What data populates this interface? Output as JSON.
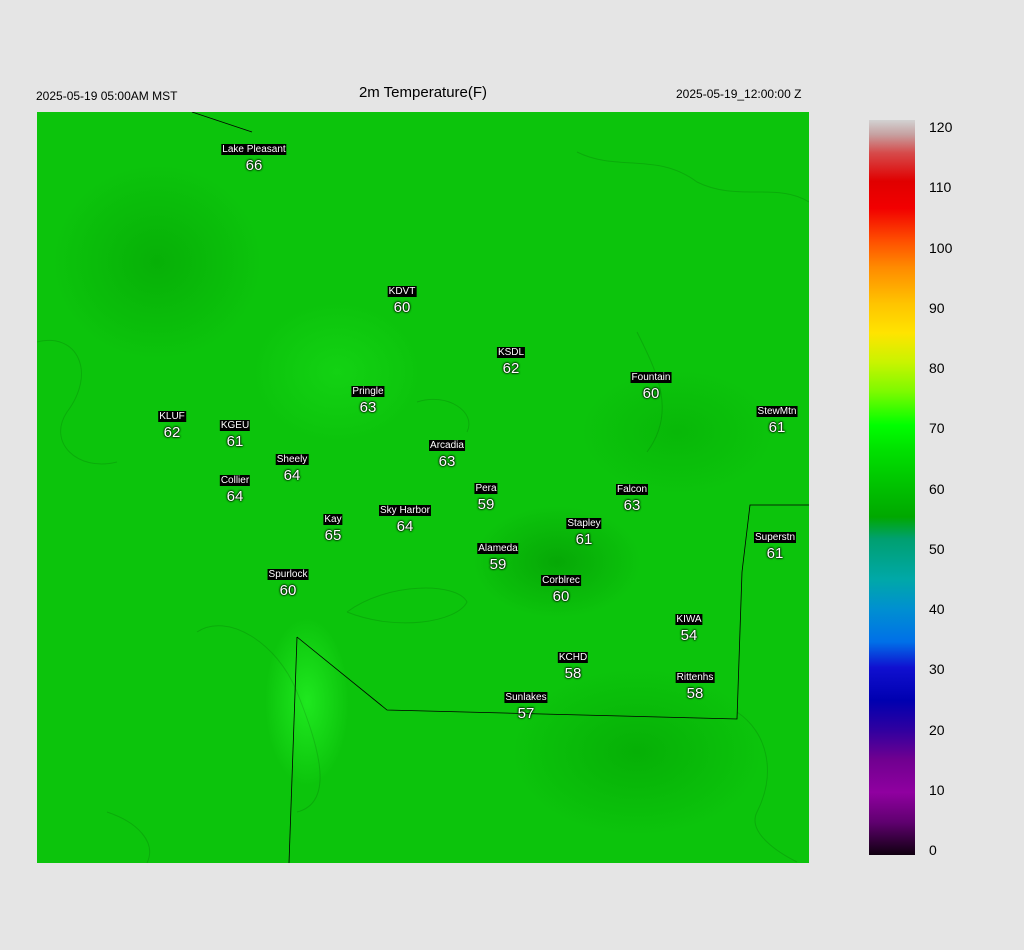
{
  "header": {
    "title": "2m Temperature(F)",
    "valid_local": "2025-05-19 05:00AM MST",
    "valid_utc": "2025-05-19_12:00:00 Z"
  },
  "colorbar": {
    "ticks": [
      "120",
      "110",
      "100",
      "90",
      "80",
      "70",
      "60",
      "50",
      "40",
      "30",
      "20",
      "10",
      "0"
    ],
    "range": [
      0,
      120
    ]
  },
  "stations": [
    {
      "name": "Lake Pleasant",
      "temp": "66"
    },
    {
      "name": "KDVT",
      "temp": "60"
    },
    {
      "name": "KSDL",
      "temp": "62"
    },
    {
      "name": "Fountain",
      "temp": "60"
    },
    {
      "name": "Pringle",
      "temp": "63"
    },
    {
      "name": "KLUF",
      "temp": "62"
    },
    {
      "name": "KGEU",
      "temp": "61"
    },
    {
      "name": "StewMtn",
      "temp": "61"
    },
    {
      "name": "Arcadia",
      "temp": "63"
    },
    {
      "name": "Sheely",
      "temp": "64"
    },
    {
      "name": "Collier",
      "temp": "64"
    },
    {
      "name": "Pera",
      "temp": "59"
    },
    {
      "name": "Falcon",
      "temp": "63"
    },
    {
      "name": "Kay",
      "temp": "65"
    },
    {
      "name": "Sky Harbor",
      "temp": "64"
    },
    {
      "name": "Stapley",
      "temp": "61"
    },
    {
      "name": "Alameda",
      "temp": "59"
    },
    {
      "name": "Superstn",
      "temp": "61"
    },
    {
      "name": "Spurlock",
      "temp": "60"
    },
    {
      "name": "Corblrec",
      "temp": "60"
    },
    {
      "name": "KIWA",
      "temp": "54"
    },
    {
      "name": "KCHD",
      "temp": "58"
    },
    {
      "name": "Rittenhs",
      "temp": "58"
    },
    {
      "name": "Sunlakes",
      "temp": "57"
    }
  ]
}
